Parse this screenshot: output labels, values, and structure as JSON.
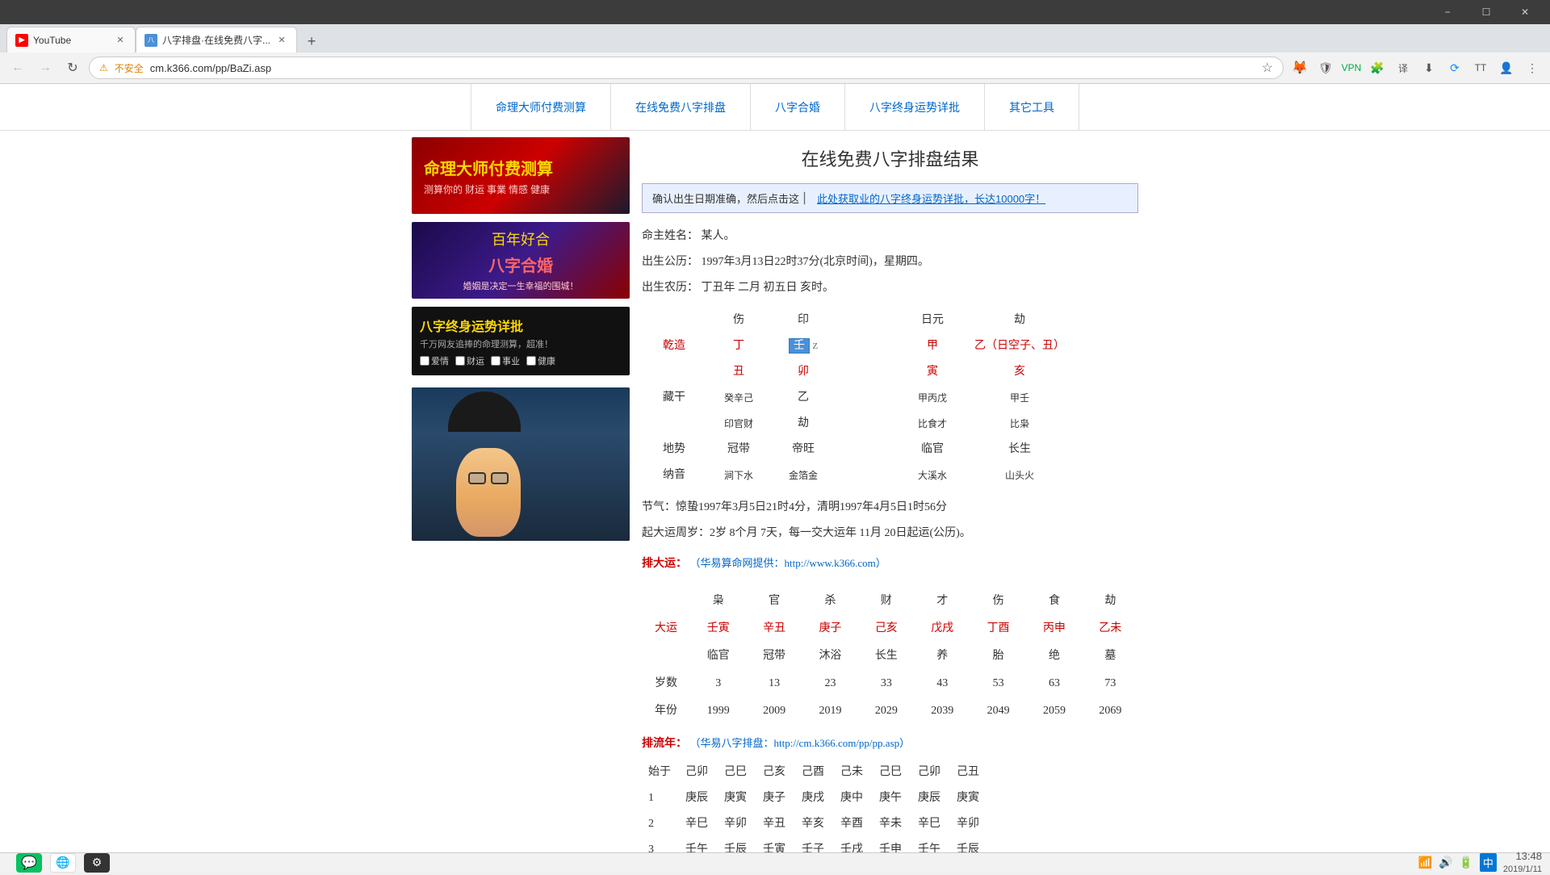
{
  "browser": {
    "tabs": [
      {
        "id": "tab1",
        "label": "YouTube",
        "favicon": "YT",
        "active": false,
        "url": "youtube.com"
      },
      {
        "id": "tab2",
        "label": "八字排盘·在线免费八字排盘结果",
        "favicon": "八",
        "active": true,
        "url": "cm.k366.com/pp/BaZi.asp"
      }
    ],
    "address": "cm.k366.com/pp/BaZi.asp",
    "secure_label": "不安全"
  },
  "site": {
    "nav_items": [
      "命理大师付费测算",
      "在线免费八字排盘",
      "八字合婚",
      "八字终身运势详批",
      "其它工具"
    ],
    "page_title": "在线免费八字排盘结果",
    "confirm_text": "确认出生日期准确，然后点击这",
    "confirm_link_text": "此处获取业的八字终身运势详批，长达10000字！",
    "person": {
      "name_label": "命主姓名：",
      "name_value": "某人。",
      "solar_label": "出生公历：",
      "solar_value": "1997年3月13日22时37分(北京时间)，星期四。",
      "lunar_label": "出生农历：",
      "lunar_value": "丁丑年  二月    初五日   亥时。"
    },
    "bazi": {
      "headers": [
        "伤",
        "印",
        "",
        "日元",
        "劫"
      ],
      "row1": [
        "乾造",
        "丁",
        "[壬]",
        "Z",
        "甲",
        "乙（日空子、丑）"
      ],
      "row2": [
        "",
        "丑",
        "卯",
        "",
        "寅",
        "亥"
      ],
      "canggan_label": "藏干",
      "canggan_values": [
        "癸辛己",
        "乙",
        "",
        "甲丙戊",
        "甲壬"
      ],
      "shishen_values": [
        "印官财",
        "劫",
        "",
        "比食才",
        "比枭"
      ],
      "dishe_label": "地势",
      "dishe_values": [
        "冠带",
        "帝旺",
        "",
        "临官",
        "长生"
      ],
      "nayin_label": "纳音",
      "nayin_values": [
        "涧下水",
        "金箔金",
        "",
        "大溪水",
        "山头火"
      ]
    },
    "jieqi": "节气：惊蛰1997年3月5日21时4分，清明1997年4月5日1时56分",
    "dayun_start": "起大运周岁：2岁  8个月  7天，每一交大运年 11月 20日起运(公历)。",
    "paida_label": "排大运：",
    "paida_link": "（华易算命网提供：http://www.k366.com）",
    "dayun_headers": [
      "枭",
      "官",
      "杀",
      "财",
      "才",
      "伤",
      "食",
      "劫"
    ],
    "dayun_row": [
      "壬寅",
      "辛丑",
      "庚子",
      "己亥",
      "戊戌",
      "丁酉",
      "丙申",
      "乙未"
    ],
    "dayun_status": [
      "临官",
      "冠带",
      "沐浴",
      "长生",
      "养",
      "胎",
      "绝",
      "墓"
    ],
    "suishu_label": "岁数",
    "suishu_values": [
      "3",
      "13",
      "23",
      "33",
      "43",
      "53",
      "63",
      "73"
    ],
    "nianfen_label": "年份",
    "nianfen_values": [
      "1999",
      "2009",
      "2019",
      "2029",
      "2039",
      "2049",
      "2059",
      "2069"
    ],
    "liunian_label": "排流年：",
    "liunian_link": "（华易八字排盘：http://cm.k366.com/pp/pp.asp）",
    "shizhu_row": [
      "己卯",
      "己巳",
      "己亥",
      "己酉",
      "己未",
      "己巳",
      "己卯",
      "己丑"
    ],
    "liunian_rows": [
      {
        "num": "1",
        "values": [
          "庚辰",
          "庚寅",
          "庚子",
          "庚戌",
          "庚中",
          "庚午",
          "庚辰",
          "庚寅"
        ]
      },
      {
        "num": "2",
        "values": [
          "辛巳",
          "辛卯",
          "辛丑",
          "辛亥",
          "辛酉",
          "辛未",
          "辛巳",
          "辛卯"
        ]
      },
      {
        "num": "3",
        "values": [
          "壬午",
          "壬辰",
          "壬寅",
          "壬子",
          "壬戌",
          "壬申",
          "壬午",
          "壬辰"
        ]
      }
    ]
  },
  "ads": {
    "ad1_title": "命理大师付费测算",
    "ad1_sub1": "测算你的  财运  事業  情感  健康",
    "ad2_title": "百年好合",
    "ad2_sub": "八字合婚",
    "ad2_tagline": "婚姻是决定一生幸福的围城！",
    "ad3_title": "八字终身运势详批",
    "ad3_sub": "千万网友追捧的命理测算，超准！",
    "ad3_checkboxes": [
      "爱情",
      "财运",
      "事业",
      "健康"
    ]
  },
  "statusbar": {
    "time": "13:48",
    "date": "2019/1/11",
    "lang": "中",
    "icons": [
      "network",
      "volume",
      "battery"
    ]
  }
}
